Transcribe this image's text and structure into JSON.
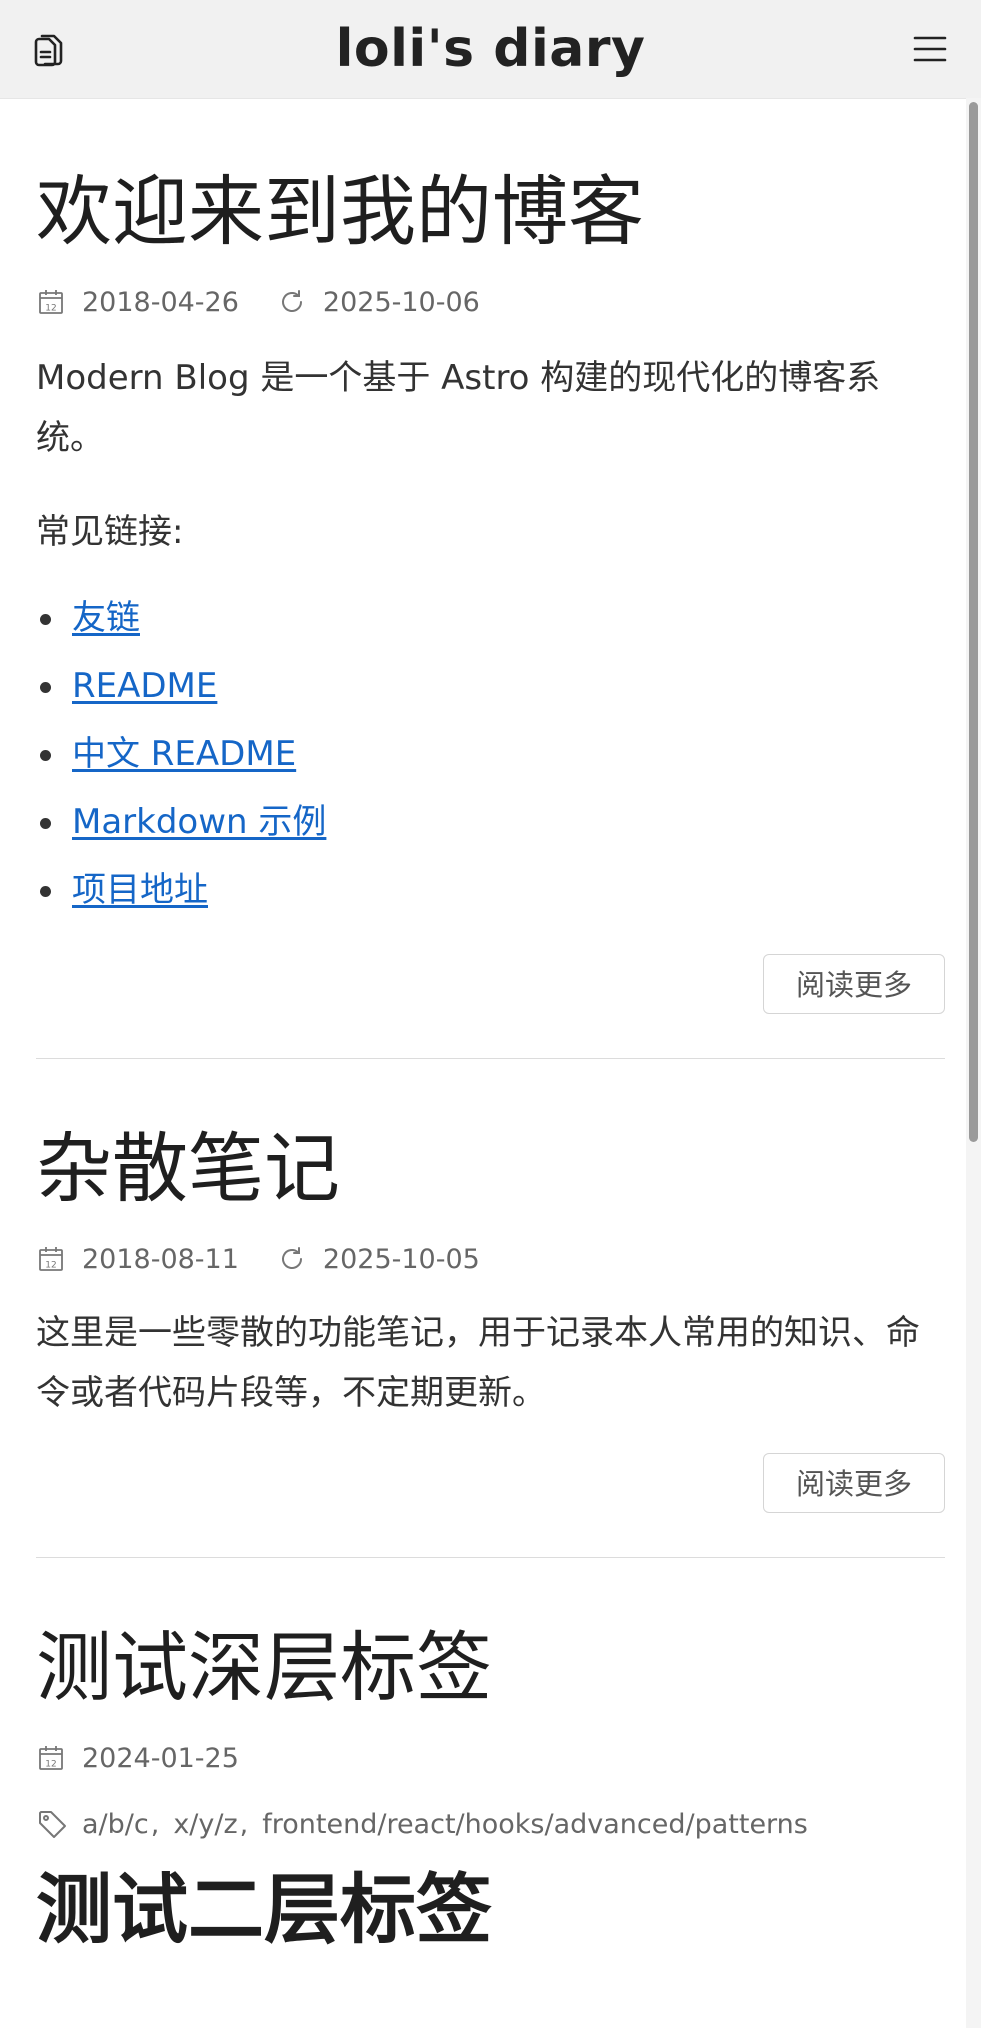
{
  "header": {
    "title": "loli's diary",
    "logo_icon": "document-copy-icon",
    "menu_icon": "hamburger-menu-icon"
  },
  "posts": [
    {
      "title": "欢迎来到我的博客",
      "published": "2018-04-26",
      "updated": "2025-10-06",
      "intro": "Modern Blog 是一个基于 Astro 构建的现代化的博客系统。",
      "links_heading": "常见链接:",
      "links": [
        "友链",
        "README",
        "中文 README",
        "Markdown 示例",
        "项目地址"
      ],
      "read_more": "阅读更多"
    },
    {
      "title": "杂散笔记",
      "published": "2018-08-11",
      "updated": "2025-10-05",
      "excerpt": "这里是一些零散的功能笔记，用于记录本人常用的知识、命令或者代码片段等，不定期更新。",
      "read_more": "阅读更多"
    },
    {
      "title": "测试深层标签",
      "published": "2024-01-25",
      "tags": [
        "a/b/c",
        "x/y/z",
        "frontend/react/hooks/advanced/patterns"
      ]
    },
    {
      "title": "测试二层标签"
    }
  ],
  "colors": {
    "link": "#1566c7",
    "header_bg": "#f1f1f1",
    "meta_text": "#666666"
  }
}
